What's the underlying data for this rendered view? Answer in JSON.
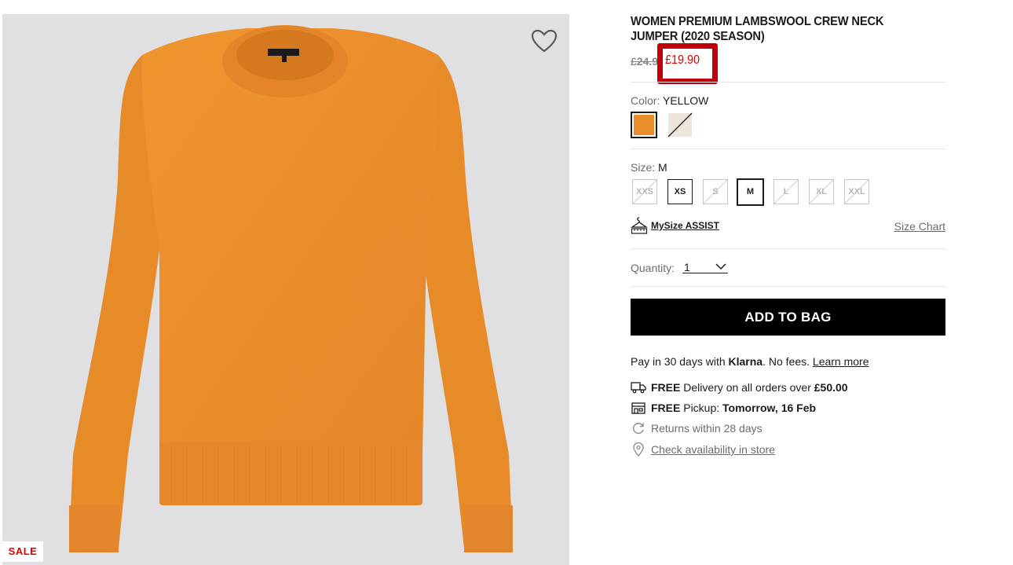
{
  "product": {
    "title": "WOMEN PREMIUM LAMBSWOOL CREW NECK JUMPER (2020 SEASON)",
    "old_price": "£24.9",
    "sale_price": "£19.90",
    "sale_badge": "SALE"
  },
  "color": {
    "label": "Color:",
    "value": "YELLOW",
    "swatches": [
      {
        "name": "yellow",
        "hex": "#e98e2a",
        "selected": true,
        "available": true
      },
      {
        "name": "cream",
        "hex": "#ece6dc",
        "selected": false,
        "available": false
      }
    ]
  },
  "size": {
    "label": "Size:",
    "value": "M",
    "options": [
      {
        "label": "XXS",
        "available": false,
        "selected": false
      },
      {
        "label": "XS",
        "available": true,
        "selected": false
      },
      {
        "label": "S",
        "available": false,
        "selected": false
      },
      {
        "label": "M",
        "available": true,
        "selected": true
      },
      {
        "label": "L",
        "available": false,
        "selected": false
      },
      {
        "label": "XL",
        "available": false,
        "selected": false
      },
      {
        "label": "XXL",
        "available": false,
        "selected": false
      }
    ],
    "mysize_label": "MySize ASSIST",
    "size_chart_label": "Size Chart"
  },
  "quantity": {
    "label": "Quantity:",
    "value": "1"
  },
  "add_to_bag_label": "ADD TO BAG",
  "klarna": {
    "prefix": "Pay in 30 days with ",
    "brand": "Klarna",
    "suffix": ". No fees. ",
    "link": "Learn more"
  },
  "delivery": {
    "free": "FREE",
    "text": " Delivery on all orders over ",
    "amount": "£50.00"
  },
  "pickup": {
    "free": "FREE",
    "text": " Pickup: ",
    "when": "Tomorrow, 16 Feb"
  },
  "returns": "Returns within 28 days",
  "store_check": "Check availability in store",
  "icons": [
    "heart-icon",
    "hanger-icon",
    "truck-icon",
    "store-icon",
    "refresh-icon",
    "location-pin-icon",
    "chevron-down-icon"
  ],
  "colors": {
    "sale_red": "#e00000",
    "highlight_red": "#c0000a",
    "sweater_orange": "#e98e2a",
    "image_bg": "#e0e0e3"
  }
}
